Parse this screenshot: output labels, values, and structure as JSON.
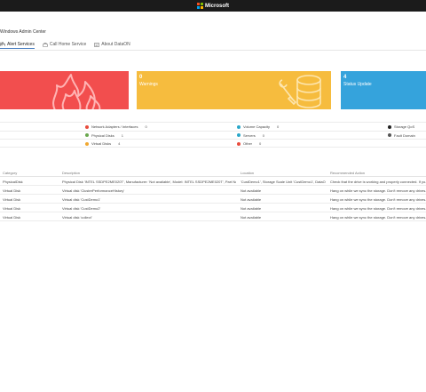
{
  "topbar": {
    "brand": "Microsoft"
  },
  "app_title": "Windows Admin Center",
  "tabs": [
    {
      "label": "Alert Services",
      "icon": "alert-icon",
      "active": true
    },
    {
      "label": "Call Home Service",
      "icon": "phone-icon",
      "active": false
    },
    {
      "label": "About DataON",
      "icon": "info-icon",
      "active": false
    }
  ],
  "cards": [
    {
      "count": "",
      "label": "",
      "color": "#f24e4e",
      "icon": "fire-icon"
    },
    {
      "count": "0",
      "label": "Warnings",
      "color": "#f6bc3e",
      "icon": "server-wrench-icon"
    },
    {
      "count": "4",
      "label": "Status Update",
      "color": "#35a3dc",
      "icon": ""
    }
  ],
  "status_rows": [
    [
      {
        "label": "Network Adapters / Interfaces",
        "value": "0",
        "color": "#e84c3d"
      },
      {
        "label": "Volume Capacity",
        "value": "0",
        "color": "#2aa7c9"
      },
      {
        "label": "Storage QoS",
        "value": "",
        "color": "#222222"
      }
    ],
    [
      {
        "label": "Physical Disks",
        "value": "1",
        "color": "#6aa84f"
      },
      {
        "label": "Servers",
        "value": "0",
        "color": "#2aa7c9"
      },
      {
        "label": "Fault Domain",
        "value": "",
        "color": "#555555"
      }
    ],
    [
      {
        "label": "Virtual Disks",
        "value": "4",
        "color": "#f0a830"
      },
      {
        "label": "Other",
        "value": "0",
        "color": "#e84c3d"
      },
      {
        "label": "",
        "value": "",
        "color": ""
      }
    ]
  ],
  "alerts": {
    "headers": [
      "Category",
      "Description",
      "Location",
      "Recommended Action"
    ],
    "rows": [
      [
        "PhysicalDisk",
        "Physical Disk 'INTEL SSDPE2ME020T', Manufacturer: 'Not available', Model: INTEL SSDPE2ME020T', Part Nu...",
        "'CustDemo1', Storage Scale Unit 'CustDemo1', DataO...",
        "Check that the drive is working and properly connected. If yo..."
      ],
      [
        "Virtual Disk",
        "Virtual disk 'ClusterPerformanceHistory'",
        "Not available",
        "Hang on while we sync the storage. Don't remove any drives..."
      ],
      [
        "Virtual Disk",
        "Virtual disk 'CustDemo1'",
        "Not available",
        "Hang on while we sync the storage. Don't remove any drives..."
      ],
      [
        "Virtual Disk",
        "Virtual disk 'CustDemo2'",
        "Not available",
        "Hang on while we sync the storage. Don't remove any drives..."
      ],
      [
        "Virtual Disk",
        "Virtual disk 'collect'",
        "Not available",
        "Hang on while we sync the storage. Don't remove any drives..."
      ]
    ]
  }
}
